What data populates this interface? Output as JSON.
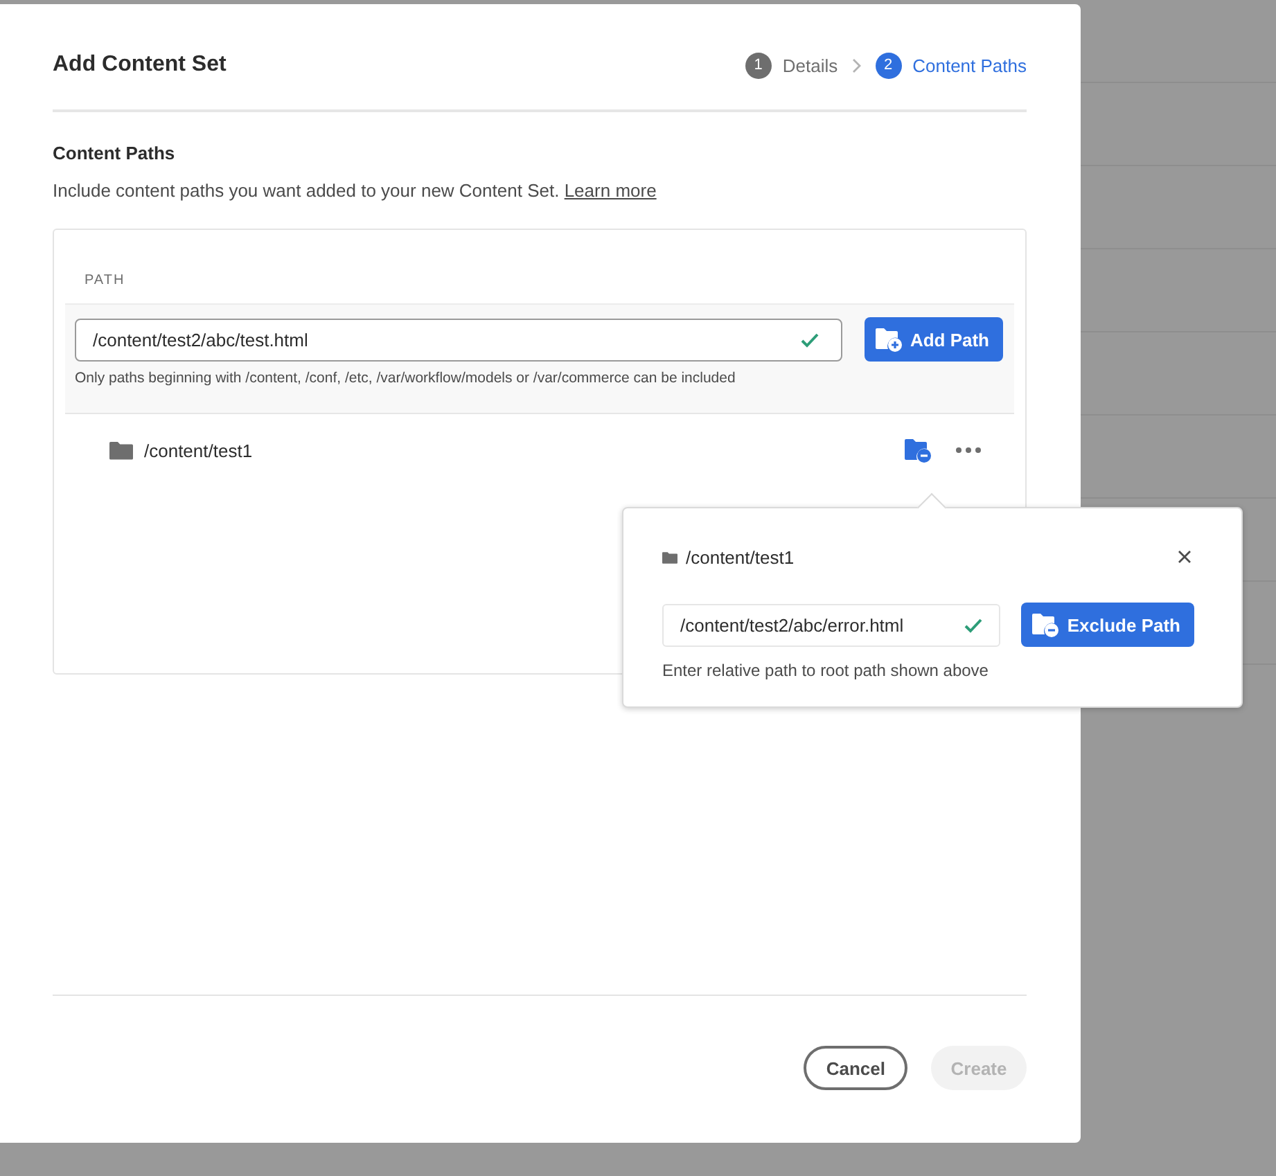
{
  "dialog": {
    "title": "Add Content Set",
    "steps": [
      {
        "number": "1",
        "label": "Details",
        "selected": false
      },
      {
        "number": "2",
        "label": "Content Paths",
        "selected": true
      }
    ],
    "section_title": "Content Paths",
    "description": "Include content paths you want added to your new Content Set.",
    "learn_more_link": "Learn more",
    "paths_panel": {
      "column_header": "PATH",
      "path_field": {
        "value": "/content/test2/abc/test.html",
        "valid": true
      },
      "add_button": "Add Path",
      "hint": "Only paths beginning with /content, /conf, /etc, /var/workflow/models or /var/commerce can be included",
      "rows": [
        {
          "path": "/content/test1"
        }
      ]
    },
    "buttons": [
      {
        "label": "Cancel",
        "disabled": false
      },
      {
        "label": "Create",
        "disabled": true
      }
    ]
  },
  "exclude_popover": {
    "root_path": "/content/test1",
    "path_field": {
      "value": "/content/test2/abc/error.html",
      "valid": true
    },
    "button": "Exclude Path",
    "hint": "Enter relative path to root path shown above"
  }
}
